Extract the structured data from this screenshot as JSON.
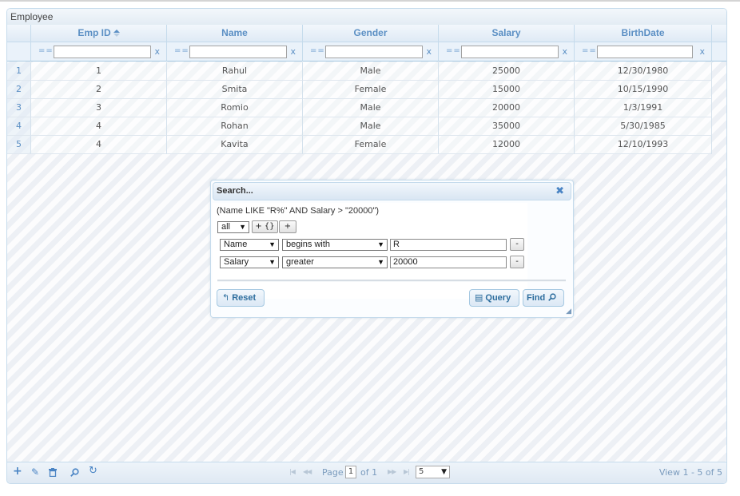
{
  "grid": {
    "caption": "Employee",
    "columns": [
      {
        "label": "Emp ID",
        "sorted": true
      },
      {
        "label": "Name"
      },
      {
        "label": "Gender"
      },
      {
        "label": "Salary"
      },
      {
        "label": "BirthDate"
      }
    ],
    "filter": {
      "operator": "==",
      "clear": "x"
    },
    "rows": [
      {
        "rn": "1",
        "cells": [
          "1",
          "Rahul",
          "Male",
          "25000",
          "12/30/1980"
        ]
      },
      {
        "rn": "2",
        "cells": [
          "2",
          "Smita",
          "Female",
          "15000",
          "10/15/1990"
        ]
      },
      {
        "rn": "3",
        "cells": [
          "3",
          "Romio",
          "Male",
          "20000",
          "1/3/1991"
        ]
      },
      {
        "rn": "4",
        "cells": [
          "4",
          "Rohan",
          "Male",
          "35000",
          "5/30/1985"
        ]
      },
      {
        "rn": "5",
        "cells": [
          "4",
          "Kavita",
          "Female",
          "12000",
          "12/10/1993"
        ]
      }
    ]
  },
  "pager": {
    "page_label": "Page",
    "page_value": "1",
    "of_label": "of 1",
    "rows_per_page": "5",
    "view_records": "View 1 - 5 of 5"
  },
  "search_dialog": {
    "title": "Search...",
    "query": "(Name LIKE \"R%\" AND Salary > \"20000\")",
    "group_op": "all",
    "add_group_label": "+ {}",
    "add_rule_label": "+",
    "rules": [
      {
        "field": "Name",
        "operator": "begins with",
        "value": "R",
        "delete": "-"
      },
      {
        "field": "Salary",
        "operator": "greater",
        "value": "20000",
        "delete": "-"
      }
    ],
    "reset_label": "Reset",
    "query_label": "Query",
    "find_label": "Find"
  },
  "colors": {
    "accent": "#5b8fc4",
    "border": "#c5dbec",
    "button_text": "#2e6e9e"
  }
}
